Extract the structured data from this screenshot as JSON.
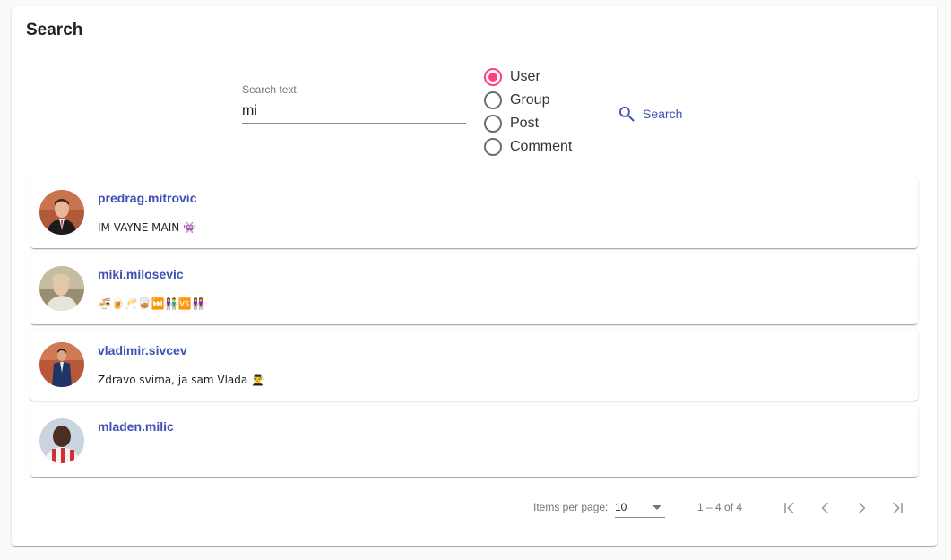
{
  "page": {
    "title": "Search"
  },
  "search": {
    "label": "Search text",
    "value": "mi",
    "button_label": "Search",
    "button_icon": "search-icon"
  },
  "search_type": {
    "selected": "User",
    "options": [
      "User",
      "Group",
      "Post",
      "Comment"
    ]
  },
  "colors": {
    "primary": "#3f51b5",
    "accent": "#ff4081"
  },
  "results": [
    {
      "username": "predrag.mitrovic",
      "bio": "IM VAYNE MAIN 👾"
    },
    {
      "username": "miki.milosevic",
      "bio": "🍜🍺🥂🥃⏭️👫🆚👭"
    },
    {
      "username": "vladimir.sivcev",
      "bio": "Zdravo svima, ja sam Vlada 👨‍🎓"
    },
    {
      "username": "mladen.milic",
      "bio": ""
    }
  ],
  "paginator": {
    "items_per_page_label": "Items per page:",
    "items_per_page": "10",
    "range_label": "1 – 4 of 4",
    "buttons": [
      "first-page-icon",
      "previous-page-icon",
      "next-page-icon",
      "last-page-icon"
    ]
  }
}
